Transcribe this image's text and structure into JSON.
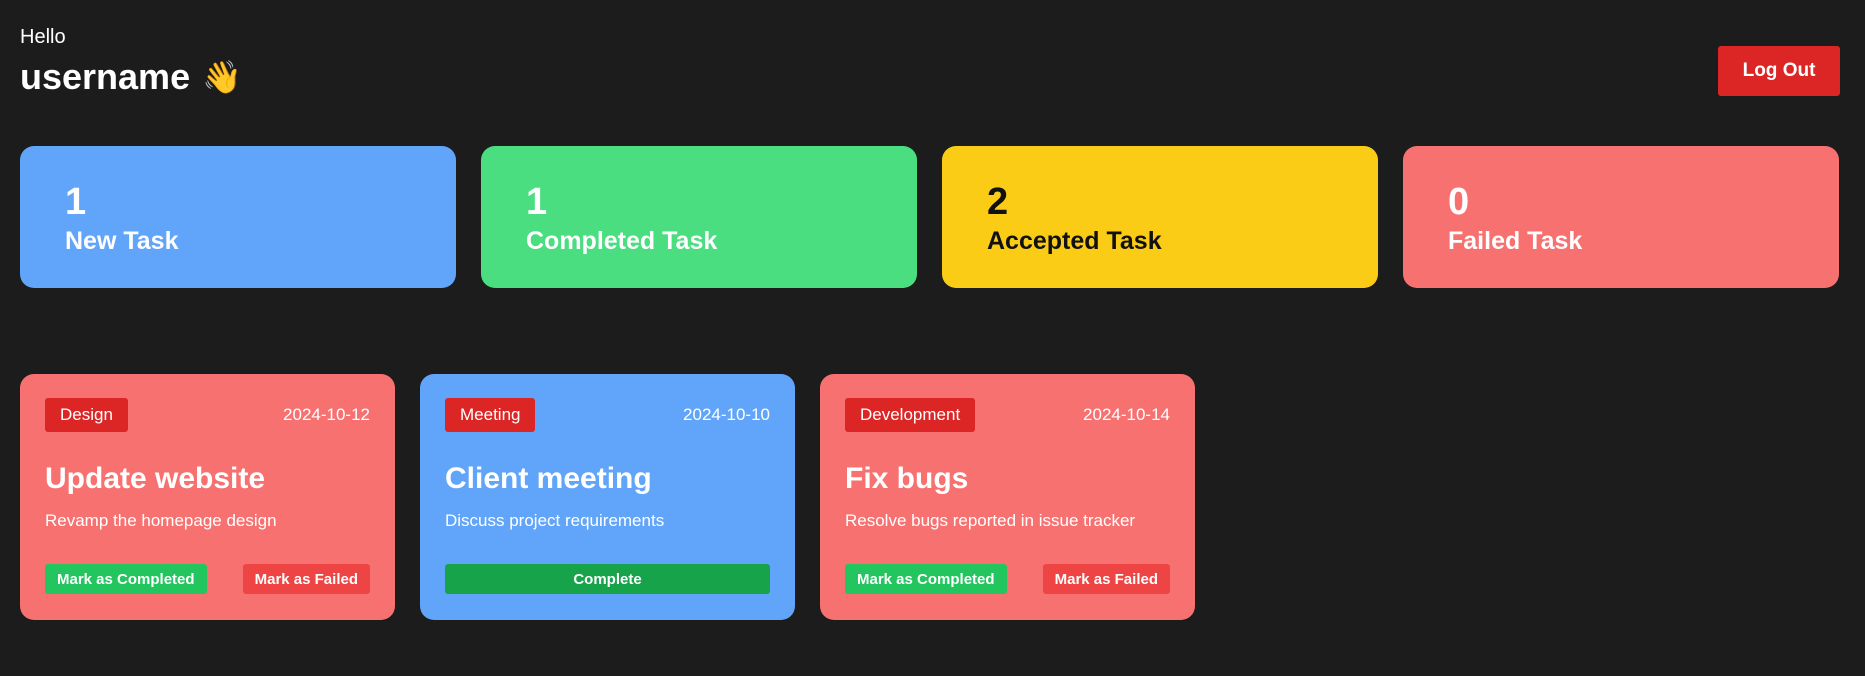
{
  "header": {
    "greeting": "Hello",
    "username": "username",
    "wave_emoji": "👋",
    "logout_label": "Log Out"
  },
  "stats": [
    {
      "count": "1",
      "label": "New Task",
      "color": "#60a5fa"
    },
    {
      "count": "1",
      "label": "Completed Task",
      "color": "#4ade80"
    },
    {
      "count": "2",
      "label": "Accepted Task",
      "color": "#facc15"
    },
    {
      "count": "0",
      "label": "Failed Task",
      "color": "#f87171"
    }
  ],
  "tasks": [
    {
      "category": "Design",
      "date": "2024-10-12",
      "title": "Update website",
      "description": "Revamp the homepage design",
      "complete_label": "Mark as Completed",
      "failed_label": "Mark as Failed"
    },
    {
      "category": "Meeting",
      "date": "2024-10-10",
      "title": "Client meeting",
      "description": "Discuss project requirements",
      "complete_label": "Complete"
    },
    {
      "category": "Development",
      "date": "2024-10-14",
      "title": "Fix bugs",
      "description": "Resolve bugs reported in issue tracker",
      "complete_label": "Mark as Completed",
      "failed_label": "Mark as Failed"
    }
  ],
  "colors": {
    "background": "#1c1c1c",
    "accent_red": "#dc2626",
    "green": "#16a34a"
  }
}
